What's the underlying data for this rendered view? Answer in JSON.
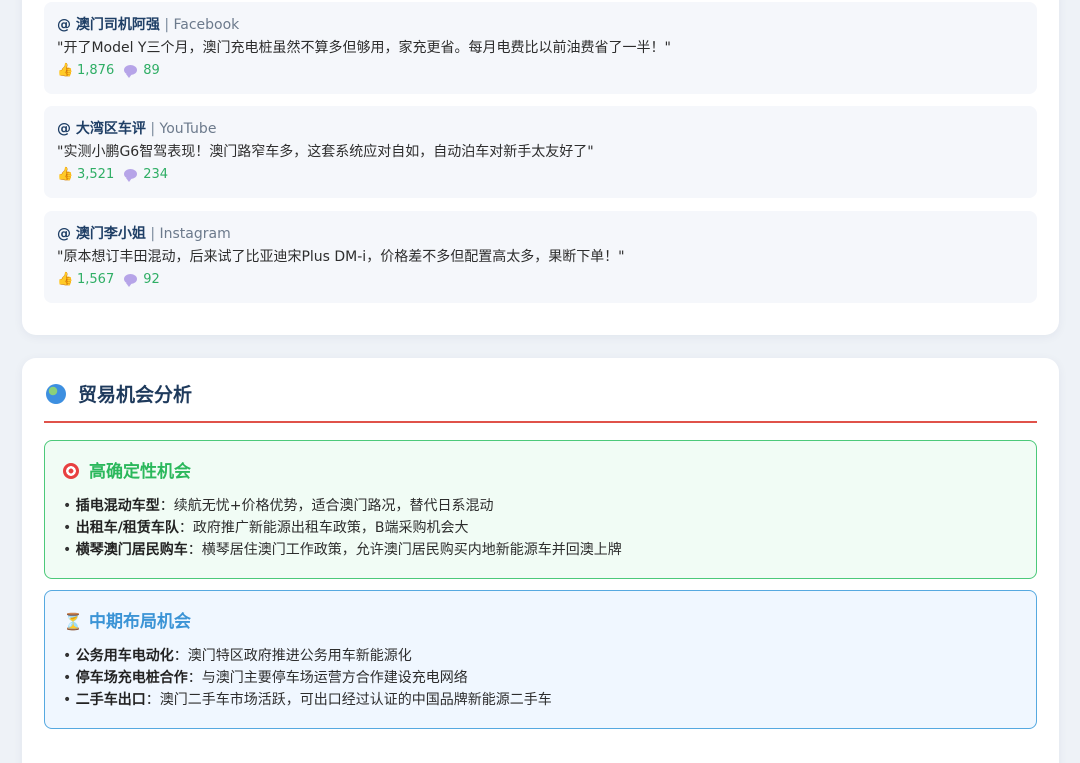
{
  "comments": [
    {
      "user": "@ 澳门司机阿强",
      "separator": "|",
      "platform": "Facebook",
      "text": "\"开了Model Y三个月，澳门充电桩虽然不算多但够用，家充更省。每月电费比以前油费省了一半！\"",
      "likes": "1,876",
      "replies": "89"
    },
    {
      "user": "@ 大湾区车评",
      "separator": "|",
      "platform": "YouTube",
      "text": "\"实测小鹏G6智驾表现！澳门路窄车多，这套系统应对自如，自动泊车对新手太友好了\"",
      "likes": "3,521",
      "replies": "234"
    },
    {
      "user": "@ 澳门李小姐",
      "separator": "|",
      "platform": "Instagram",
      "text": "\"原本想订丰田混动，后来试了比亚迪宋Plus DM-i，价格差不多但配置高太多，果断下单！\"",
      "likes": "1,567",
      "replies": "92"
    }
  ],
  "icons": {
    "like": "thumbs-up-icon",
    "reply": "speech-bubble-icon",
    "section": "globe-icon",
    "high": "target-icon",
    "mid": "hourglass-icon"
  },
  "trade": {
    "title": "贸易机会分析",
    "high": {
      "title": "高确定性机会",
      "items": [
        {
          "label": "插电混动车型",
          "desc": "：续航无忧+价格优势，适合澳门路况，替代日系混动"
        },
        {
          "label": "出租车/租赁车队",
          "desc": "：政府推广新能源出租车政策，B端采购机会大"
        },
        {
          "label": "横琴澳门居民购车",
          "desc": "：横琴居住澳门工作政策，允许澳门居民购买内地新能源车并回澳上牌"
        }
      ]
    },
    "mid": {
      "title": "中期布局机会",
      "items": [
        {
          "label": "公务用车电动化",
          "desc": "：澳门特区政府推进公务用车新能源化"
        },
        {
          "label": "停车场充电桩合作",
          "desc": "：与澳门主要停车场运营方合作建设充电网络"
        },
        {
          "label": "二手车出口",
          "desc": "：澳门二手车市场活跃，可出口经过认证的中国品牌新能源二手车"
        }
      ]
    }
  },
  "colors": {
    "accent_red": "#e0524a",
    "green": "#2bb85c",
    "blue": "#3b94d6",
    "title": "#1e3a5c"
  }
}
